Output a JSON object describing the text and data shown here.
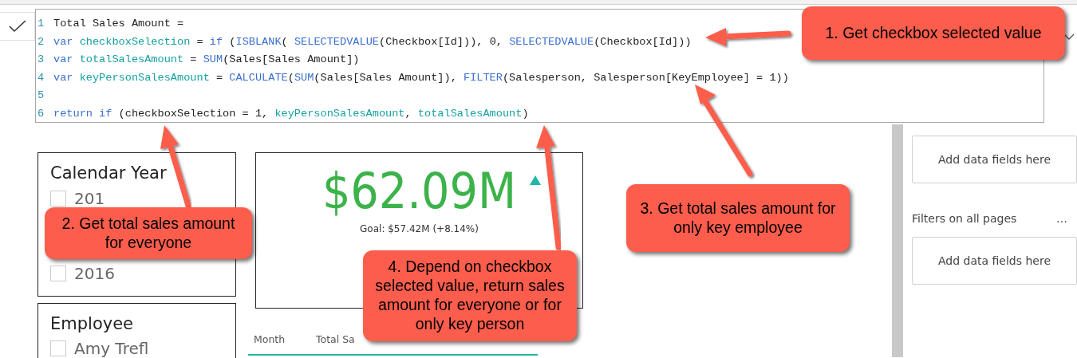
{
  "formula_bar": {
    "lines": [
      {
        "number": "1",
        "tokens": [
          {
            "kind": "plain",
            "text": "Total Sales Amount ="
          }
        ]
      },
      {
        "number": "2",
        "tokens": [
          {
            "kind": "keyword",
            "text": "var "
          },
          {
            "kind": "variable",
            "text": "checkboxSelection"
          },
          {
            "kind": "plain",
            "text": " = "
          },
          {
            "kind": "keyword",
            "text": "if"
          },
          {
            "kind": "plain",
            "text": " ("
          },
          {
            "kind": "function",
            "text": "ISBLANK"
          },
          {
            "kind": "plain",
            "text": "( "
          },
          {
            "kind": "function",
            "text": "SELECTEDVALUE"
          },
          {
            "kind": "plain",
            "text": "(Checkbox[Id])), 0, "
          },
          {
            "kind": "function",
            "text": "SELECTEDVALUE"
          },
          {
            "kind": "plain",
            "text": "(Checkbox[Id]))"
          }
        ]
      },
      {
        "number": "3",
        "tokens": [
          {
            "kind": "keyword",
            "text": "var "
          },
          {
            "kind": "variable",
            "text": "totalSalesAmount"
          },
          {
            "kind": "plain",
            "text": " = "
          },
          {
            "kind": "function",
            "text": "SUM"
          },
          {
            "kind": "plain",
            "text": "(Sales[Sales Amount])"
          }
        ]
      },
      {
        "number": "4",
        "tokens": [
          {
            "kind": "keyword",
            "text": "var "
          },
          {
            "kind": "variable",
            "text": "keyPersonSalesAmount"
          },
          {
            "kind": "plain",
            "text": " = "
          },
          {
            "kind": "function",
            "text": "CALCULATE"
          },
          {
            "kind": "plain",
            "text": "("
          },
          {
            "kind": "function",
            "text": "SUM"
          },
          {
            "kind": "plain",
            "text": "(Sales[Sales Amount]), "
          },
          {
            "kind": "function",
            "text": "FILTER"
          },
          {
            "kind": "plain",
            "text": "(Salesperson, Salesperson[KeyEmployee] = 1))"
          }
        ]
      },
      {
        "number": "5"
      },
      {
        "number": "6",
        "tokens": [
          {
            "kind": "keyword",
            "text": "return if"
          },
          {
            "kind": "plain",
            "text": " ("
          },
          {
            "kind": "plain",
            "text": "checkboxSelection = 1, "
          },
          {
            "kind": "variable",
            "text": "keyPersonSalesAmount"
          },
          {
            "kind": "plain",
            "text": ", "
          },
          {
            "kind": "variable",
            "text": "totalSalesAmount"
          },
          {
            "kind": "plain",
            "text": ")"
          }
        ]
      }
    ]
  },
  "slicers": [
    {
      "title": "Calendar Year",
      "items": [
        {
          "label": "201",
          "checked": false
        },
        {
          "label": "2016",
          "checked": false
        }
      ]
    },
    {
      "title": "Employee",
      "items": [
        {
          "label": "Amy Trefl",
          "checked": false
        }
      ]
    }
  ],
  "kpi": {
    "value": "$62.09M",
    "goal": "Goal: $57.42M (+8.14%)"
  },
  "table": {
    "columns": [
      "Month",
      "Total Sa"
    ]
  },
  "filters_pane": {
    "well_1": "Add data fields here",
    "section_title": "Filters on all pages",
    "more": "…",
    "well_2": "Add data fields here"
  },
  "callouts": [
    {
      "text": "1. Get checkbox selected value"
    },
    {
      "text": "2. Get total sales amount for everyone"
    },
    {
      "text": "3. Get total sales amount for only key employee"
    },
    {
      "text": "4. Depend on checkbox selected value, return sales amount for everyone or for only key person"
    }
  ]
}
